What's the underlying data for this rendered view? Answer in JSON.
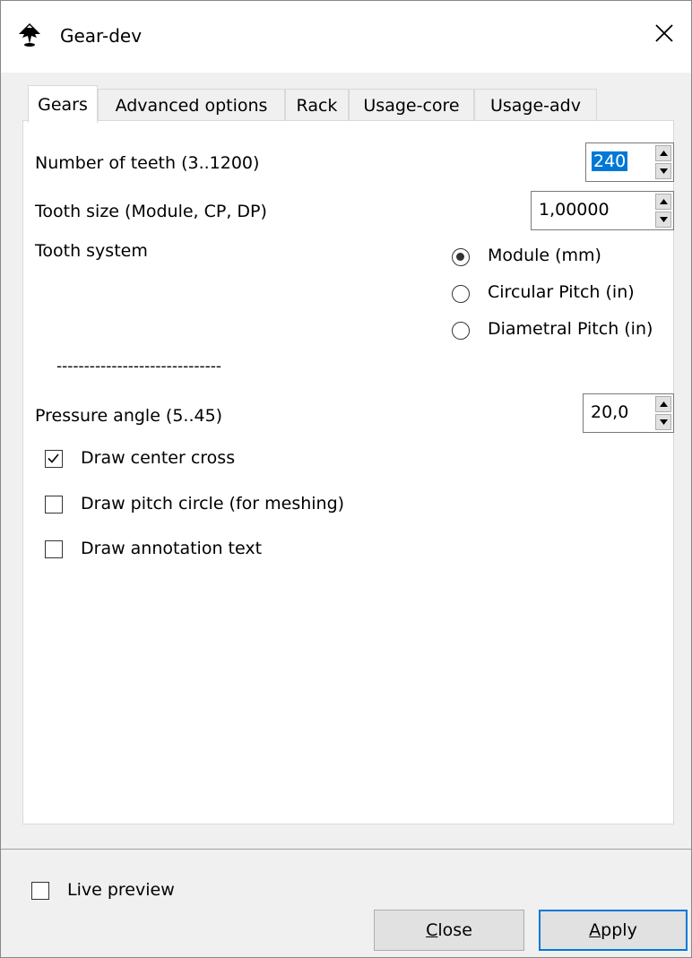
{
  "window": {
    "title": "Gear-dev",
    "icon": "inkscape-icon",
    "close_icon": "close-icon"
  },
  "tabs": [
    {
      "label": "Gears",
      "active": true
    },
    {
      "label": "Advanced options",
      "active": false
    },
    {
      "label": "Rack",
      "active": false
    },
    {
      "label": "Usage-core",
      "active": false
    },
    {
      "label": "Usage-adv",
      "active": false
    }
  ],
  "gears": {
    "teeth": {
      "label": "Number of teeth (3..1200)",
      "value": "240"
    },
    "tooth_size": {
      "label": "Tooth size (Module, CP, DP)",
      "value": "1,00000"
    },
    "tooth_system": {
      "label": "Tooth system",
      "options": [
        {
          "label": "Module (mm)",
          "selected": true
        },
        {
          "label": "Circular Pitch (in)",
          "selected": false
        },
        {
          "label": "Diametral Pitch (in)",
          "selected": false
        }
      ]
    },
    "divider": "------------------------------",
    "pressure_angle": {
      "label": "Pressure angle (5..45)",
      "value": "20,0"
    },
    "checkboxes": [
      {
        "label": "Draw center cross",
        "checked": true
      },
      {
        "label": "Draw pitch circle (for meshing)",
        "checked": false
      },
      {
        "label": "Draw annotation text",
        "checked": false
      }
    ]
  },
  "footer": {
    "live_preview": {
      "label": "Live preview",
      "checked": false
    },
    "close": {
      "mnemonic": "C",
      "rest": "lose"
    },
    "apply": {
      "mnemonic": "A",
      "rest": "pply"
    }
  }
}
